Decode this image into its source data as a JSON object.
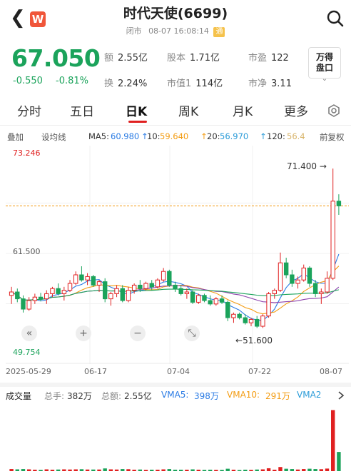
{
  "header": {
    "title": "时代天使(6699)",
    "status": "闭市",
    "datetime": "08-07 16:08:14",
    "tag": "通",
    "logo_letter": "W"
  },
  "quote": {
    "price": "67.050",
    "change": "-0.550",
    "change_pct": "-0.81%",
    "color": "#1ba35b"
  },
  "stats": [
    {
      "key": "额",
      "value": "2.55亿"
    },
    {
      "key": "股本",
      "value": "1.71亿"
    },
    {
      "key": "市盈",
      "value": "122"
    },
    {
      "key": "换",
      "value": "2.24%"
    },
    {
      "key": "市值1",
      "value": "114亿"
    },
    {
      "key": "市净",
      "value": "3.11"
    }
  ],
  "wande_button": {
    "line1": "万得",
    "line2": "盘口"
  },
  "tabs": [
    "分时",
    "五日",
    "日K",
    "周K",
    "月K",
    "更多"
  ],
  "active_tab": "日K",
  "indicator_bar": {
    "overlay": "叠加",
    "drawline": "设均线",
    "ma5_label": "MA5:",
    "ma5_value": "60.980",
    "ma10_label": "10:",
    "ma10_value": "59.640",
    "ma20_label": "20:",
    "ma20_value": "56.970",
    "ma120_label": "120:",
    "ma120_value": "56.4",
    "adjust": "前复权"
  },
  "chart_labels": {
    "top_price": "73.246",
    "mid_price": "61.500",
    "bottom_price": "49.754",
    "high_annotation": "71.400",
    "low_annotation": "51.600"
  },
  "chart_data": {
    "type": "candlestick",
    "ylim": [
      49.754,
      73.246
    ],
    "dates_shown": [
      "2025-05-29",
      "06-17",
      "07-04",
      "07-22",
      "08-07"
    ],
    "last_close": 67.05,
    "high": 71.4,
    "low": 51.6,
    "candles": [
      [
        56.6,
        57.6,
        55.6,
        57.0
      ],
      [
        57.0,
        57.4,
        55.8,
        56.2
      ],
      [
        56.2,
        56.6,
        54.6,
        55.0
      ],
      [
        55.0,
        56.4,
        54.8,
        56.0
      ],
      [
        56.0,
        56.8,
        55.6,
        56.4
      ],
      [
        56.4,
        56.9,
        55.9,
        56.2
      ],
      [
        56.2,
        57.2,
        55.6,
        56.8
      ],
      [
        56.8,
        57.6,
        56.4,
        57.4
      ],
      [
        57.4,
        58.0,
        56.6,
        56.8
      ],
      [
        56.8,
        57.6,
        56.0,
        57.2
      ],
      [
        57.2,
        58.4,
        57.0,
        58.0
      ],
      [
        58.0,
        59.4,
        57.8,
        59.0
      ],
      [
        59.0,
        60.0,
        58.2,
        58.4
      ],
      [
        58.4,
        59.2,
        57.8,
        58.8
      ],
      [
        58.8,
        59.0,
        57.6,
        57.8
      ],
      [
        57.8,
        58.4,
        57.0,
        58.2
      ],
      [
        58.2,
        58.6,
        55.8,
        56.2
      ],
      [
        56.2,
        57.0,
        55.4,
        56.8
      ],
      [
        56.8,
        57.8,
        56.4,
        57.4
      ],
      [
        57.4,
        57.8,
        55.8,
        56.0
      ],
      [
        56.0,
        57.6,
        55.8,
        57.2
      ],
      [
        57.2,
        58.0,
        56.8,
        57.8
      ],
      [
        57.8,
        58.4,
        57.0,
        57.4
      ],
      [
        57.4,
        58.2,
        57.2,
        58.0
      ],
      [
        58.0,
        58.4,
        57.2,
        57.6
      ],
      [
        57.6,
        58.6,
        57.4,
        58.4
      ],
      [
        58.4,
        59.8,
        58.2,
        59.4
      ],
      [
        59.4,
        59.6,
        57.6,
        57.8
      ],
      [
        57.8,
        58.2,
        57.0,
        57.4
      ],
      [
        57.4,
        57.8,
        56.6,
        56.8
      ],
      [
        56.8,
        57.4,
        56.2,
        57.0
      ],
      [
        57.0,
        57.2,
        55.6,
        55.8
      ],
      [
        55.8,
        56.8,
        55.6,
        56.6
      ],
      [
        56.6,
        56.8,
        55.8,
        56.0
      ],
      [
        56.0,
        56.6,
        55.4,
        55.6
      ],
      [
        55.6,
        56.4,
        55.4,
        56.2
      ],
      [
        56.2,
        56.6,
        55.6,
        55.8
      ],
      [
        55.8,
        56.0,
        53.6,
        54.0
      ],
      [
        54.0,
        54.6,
        53.4,
        54.4
      ],
      [
        54.4,
        54.6,
        53.8,
        54.0
      ],
      [
        54.0,
        54.4,
        53.2,
        53.4
      ],
      [
        53.4,
        54.0,
        53.0,
        53.8
      ],
      [
        53.8,
        54.2,
        52.8,
        53.0
      ],
      [
        53.0,
        54.4,
        52.8,
        54.2
      ],
      [
        54.2,
        57.0,
        54.0,
        56.8
      ],
      [
        56.8,
        57.4,
        56.2,
        57.2
      ],
      [
        57.2,
        61.6,
        57.0,
        60.4
      ],
      [
        60.4,
        61.0,
        58.6,
        59.0
      ],
      [
        59.0,
        59.6,
        57.6,
        58.0
      ],
      [
        58.0,
        58.8,
        57.4,
        58.4
      ],
      [
        58.4,
        60.2,
        58.2,
        59.8
      ],
      [
        59.8,
        60.0,
        57.6,
        58.0
      ],
      [
        58.0,
        58.4,
        56.4,
        56.8
      ],
      [
        56.8,
        57.4,
        55.6,
        57.0
      ],
      [
        57.0,
        59.4,
        56.8,
        58.6
      ],
      [
        58.6,
        71.4,
        58.4,
        67.6
      ],
      [
        67.6,
        68.4,
        66.0,
        67.05
      ]
    ],
    "ma_lines": [
      {
        "name": "MA5",
        "color": "#2a7be4"
      },
      {
        "name": "MA10",
        "color": "#f39c12"
      },
      {
        "name": "MA20",
        "color": "#8e44ad"
      },
      {
        "name": "MA120",
        "color": "#1ba35b"
      }
    ]
  },
  "controls": [
    "«",
    "+",
    "−",
    "⤡"
  ],
  "volume_bar": {
    "title": "成交量",
    "total_hands_label": "总手:",
    "total_hands_value": "382万",
    "total_amount_label": "总额:",
    "total_amount_value": "2.55亿",
    "vma5_label": "VMA5:",
    "vma5_value": "398万",
    "vma10_label": "VMA10:",
    "vma10_value": "291万",
    "vma20_label": "VMA2"
  },
  "colors": {
    "up": "#e02020",
    "down": "#1ba35b",
    "accent_tab": "#e02020",
    "tag_bg": "#f5c24b",
    "logo_bg": "#f0563a"
  }
}
